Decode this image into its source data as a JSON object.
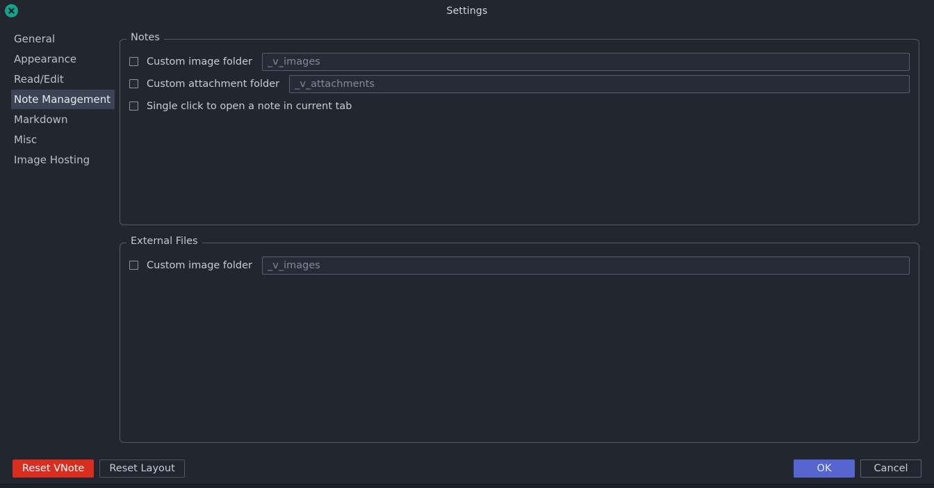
{
  "window": {
    "title": "Settings",
    "close_icon": "close-circle-icon"
  },
  "sidebar": {
    "items": [
      {
        "label": "General",
        "selected": false
      },
      {
        "label": "Appearance",
        "selected": false
      },
      {
        "label": "Read/Edit",
        "selected": false
      },
      {
        "label": "Note Management",
        "selected": true
      },
      {
        "label": "Markdown",
        "selected": false
      },
      {
        "label": "Misc",
        "selected": false
      },
      {
        "label": "Image Hosting",
        "selected": false
      }
    ]
  },
  "groups": {
    "notes": {
      "title": "Notes",
      "rows": [
        {
          "checkbox_label": "Custom image folder",
          "checked": false,
          "field_placeholder": "_v_images",
          "field_value": ""
        },
        {
          "checkbox_label": "Custom attachment folder",
          "checked": false,
          "field_placeholder": "_v_attachments",
          "field_value": ""
        },
        {
          "checkbox_label": "Single click to open a note in current tab",
          "checked": false
        }
      ]
    },
    "external_files": {
      "title": "External Files",
      "rows": [
        {
          "checkbox_label": "Custom image folder",
          "checked": false,
          "field_placeholder": "_v_images",
          "field_value": ""
        }
      ]
    }
  },
  "buttons": {
    "reset_vnote": "Reset VNote",
    "reset_layout": "Reset Layout",
    "ok": "OK",
    "cancel": "Cancel"
  },
  "colors": {
    "dialog_bg": "#22262e",
    "selected_item_bg": "#3b4354",
    "close_icon_bg": "#15a48a",
    "danger_button_bg": "#d92d20",
    "primary_button_bg": "#5765cf",
    "groupbox_border": "#515b70",
    "text": "#c6ccd8",
    "placeholder_text": "#8089a0"
  }
}
